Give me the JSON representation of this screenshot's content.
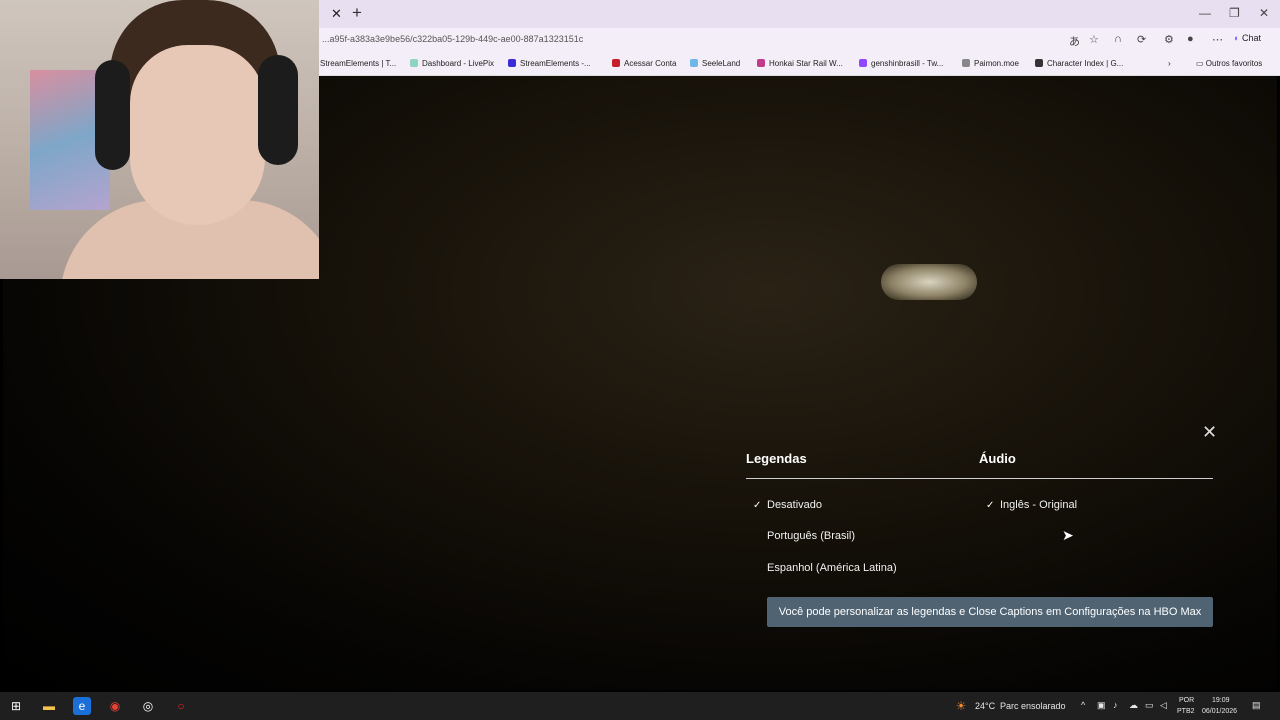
{
  "browser": {
    "url": "...a95f-a383a3e9be56/c322ba05-129b-449c-ae00-887a1323151c",
    "chat_label": "Chat",
    "bookmarks": [
      {
        "label": "StreamElements | T...",
        "color": "#7a3cff"
      },
      {
        "label": "Dashboard - LivePix",
        "color": "#8fd3c0"
      },
      {
        "label": "StreamElements -...",
        "color": "#3b2bd6"
      },
      {
        "label": "Acessar Conta",
        "color": "#c81e2b"
      },
      {
        "label": "SeeleLand",
        "color": "#6fb7e6"
      },
      {
        "label": "Honkai Star Rail W...",
        "color": "#c23b88"
      },
      {
        "label": "genshinbrasill - Tw...",
        "color": "#9146ff"
      },
      {
        "label": "Paimon.moe",
        "color": "#888888"
      },
      {
        "label": "Character Index | G...",
        "color": "#333333"
      }
    ],
    "other_favorites": "Outros favoritos"
  },
  "player": {
    "subtitles_header": "Legendas",
    "audio_header": "Áudio",
    "subtitle_options": [
      {
        "label": "Desativado",
        "selected": true
      },
      {
        "label": "Português (Brasil)",
        "selected": false
      },
      {
        "label": "Espanhol (América Latina)",
        "selected": false
      }
    ],
    "audio_options": [
      {
        "label": "Inglês - Original",
        "selected": true
      }
    ],
    "check_glyph": "✓",
    "info_banner": "Você pode personalizar as legendas e Close Captions em Configurações na HBO Max",
    "close_glyph": "✕"
  },
  "taskbar": {
    "weather_temp": "24°C",
    "weather_desc": "Parc ensolarado",
    "lang_top": "POR",
    "lang_bottom": "PTB2",
    "time": "19:09",
    "date": "06/01/2026"
  }
}
